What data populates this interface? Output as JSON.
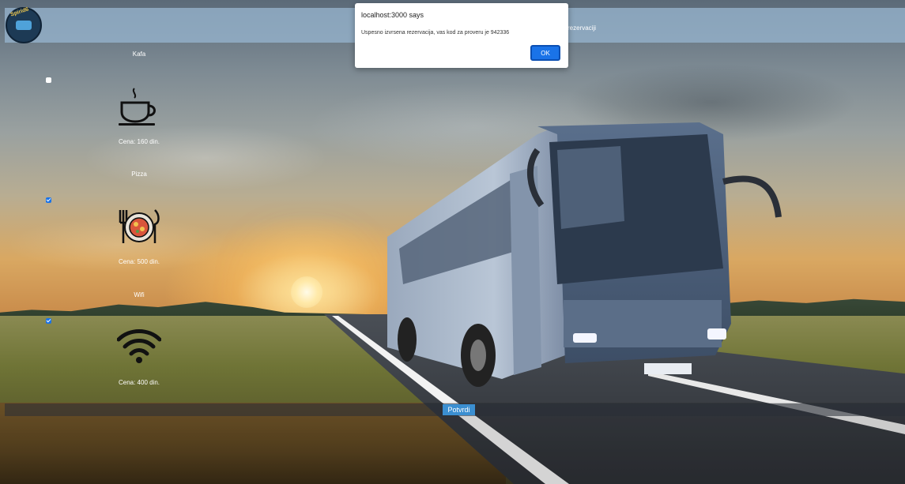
{
  "navbar": {
    "logo_text": "Spirid6",
    "link_rezervacija": "rezervaciji"
  },
  "services": [
    {
      "name": "Kafa",
      "price": "Cena: 160 din.",
      "checked": false,
      "icon": "coffee-cup-icon"
    },
    {
      "name": "Pizza",
      "price": "Cena: 500 din.",
      "checked": true,
      "icon": "plate-fork-knife-icon"
    },
    {
      "name": "Wifi",
      "price": "Cena: 400 din.",
      "checked": true,
      "icon": "wifi-icon"
    }
  ],
  "confirm": {
    "label": "Potvrdi"
  },
  "dialog": {
    "title": "localhost:3000 says",
    "message": "Uspesno izvrsena rezervacija, vas kod za proveru je 942336",
    "ok_label": "OK"
  },
  "colors": {
    "navbar": "#96b4cd",
    "accent": "#1a73e8",
    "confirm_button": "#3b8fd1"
  }
}
